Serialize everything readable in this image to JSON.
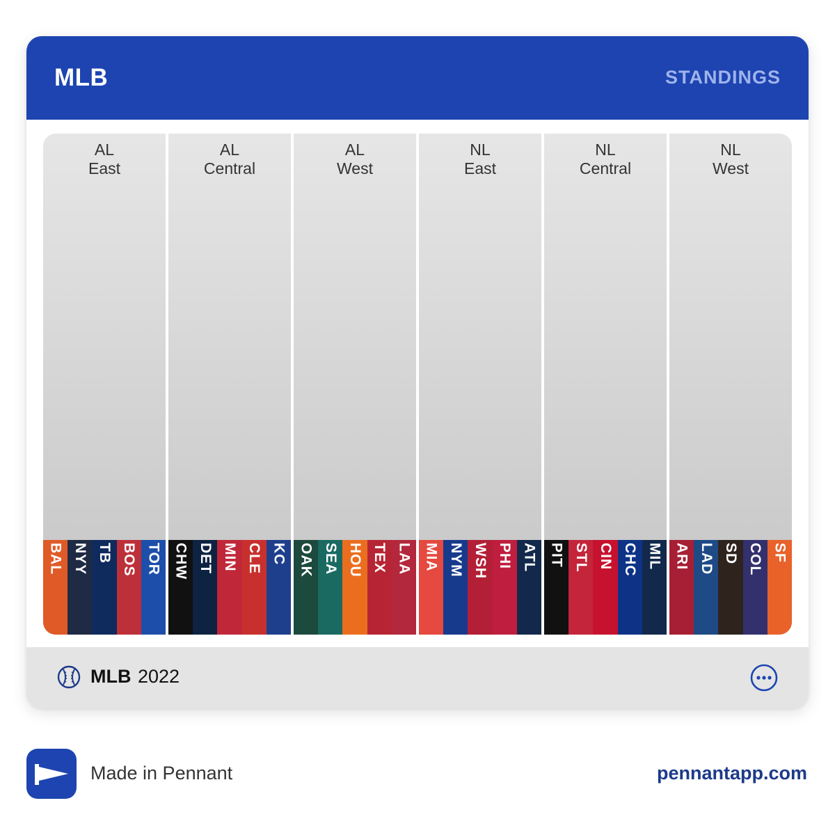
{
  "header": {
    "title": "MLB",
    "standings_label": "STANDINGS"
  },
  "divisions": [
    {
      "line1": "AL",
      "line2": "East",
      "teams": [
        {
          "abbr": "BAL",
          "color": "#df5a27"
        },
        {
          "abbr": "NYY",
          "color": "#1f2a44"
        },
        {
          "abbr": "TB",
          "color": "#0f2a5c"
        },
        {
          "abbr": "BOS",
          "color": "#bd3039"
        },
        {
          "abbr": "TOR",
          "color": "#1d4faa"
        }
      ]
    },
    {
      "line1": "AL",
      "line2": "Central",
      "teams": [
        {
          "abbr": "CHW",
          "color": "#111111"
        },
        {
          "abbr": "DET",
          "color": "#0e2242"
        },
        {
          "abbr": "MIN",
          "color": "#c0283a"
        },
        {
          "abbr": "CLE",
          "color": "#c8302e"
        },
        {
          "abbr": "KC",
          "color": "#1e3f8c"
        }
      ]
    },
    {
      "line1": "AL",
      "line2": "West",
      "teams": [
        {
          "abbr": "OAK",
          "color": "#1c4a3c"
        },
        {
          "abbr": "SEA",
          "color": "#1a6a62"
        },
        {
          "abbr": "HOU",
          "color": "#eb6e1f"
        },
        {
          "abbr": "TEX",
          "color": "#b72535"
        },
        {
          "abbr": "LAA",
          "color": "#b3283c"
        }
      ]
    },
    {
      "line1": "NL",
      "line2": "East",
      "teams": [
        {
          "abbr": "MIA",
          "color": "#e5493f"
        },
        {
          "abbr": "NYM",
          "color": "#173a8c"
        },
        {
          "abbr": "WSH",
          "color": "#b31f36"
        },
        {
          "abbr": "PHI",
          "color": "#bf1e3e"
        },
        {
          "abbr": "ATL",
          "color": "#13294b"
        }
      ]
    },
    {
      "line1": "NL",
      "line2": "Central",
      "teams": [
        {
          "abbr": "PIT",
          "color": "#111111"
        },
        {
          "abbr": "STL",
          "color": "#c4253a"
        },
        {
          "abbr": "CIN",
          "color": "#c6122e"
        },
        {
          "abbr": "CHC",
          "color": "#0e3386"
        },
        {
          "abbr": "MIL",
          "color": "#13294b"
        }
      ]
    },
    {
      "line1": "NL",
      "line2": "West",
      "teams": [
        {
          "abbr": "ARI",
          "color": "#a71f35"
        },
        {
          "abbr": "LAD",
          "color": "#1e4a86"
        },
        {
          "abbr": "SD",
          "color": "#2f241d"
        },
        {
          "abbr": "COL",
          "color": "#33306e"
        },
        {
          "abbr": "SF",
          "color": "#e8622a"
        }
      ]
    }
  ],
  "footer": {
    "league": "MLB",
    "year": "2022",
    "ball_icon": "baseball-icon",
    "more_icon": "more-options-icon"
  },
  "branding": {
    "text": "Made in Pennant",
    "url": "pennantapp.com",
    "icon": "pennant-logo-icon",
    "accent": "#1d44b0"
  }
}
